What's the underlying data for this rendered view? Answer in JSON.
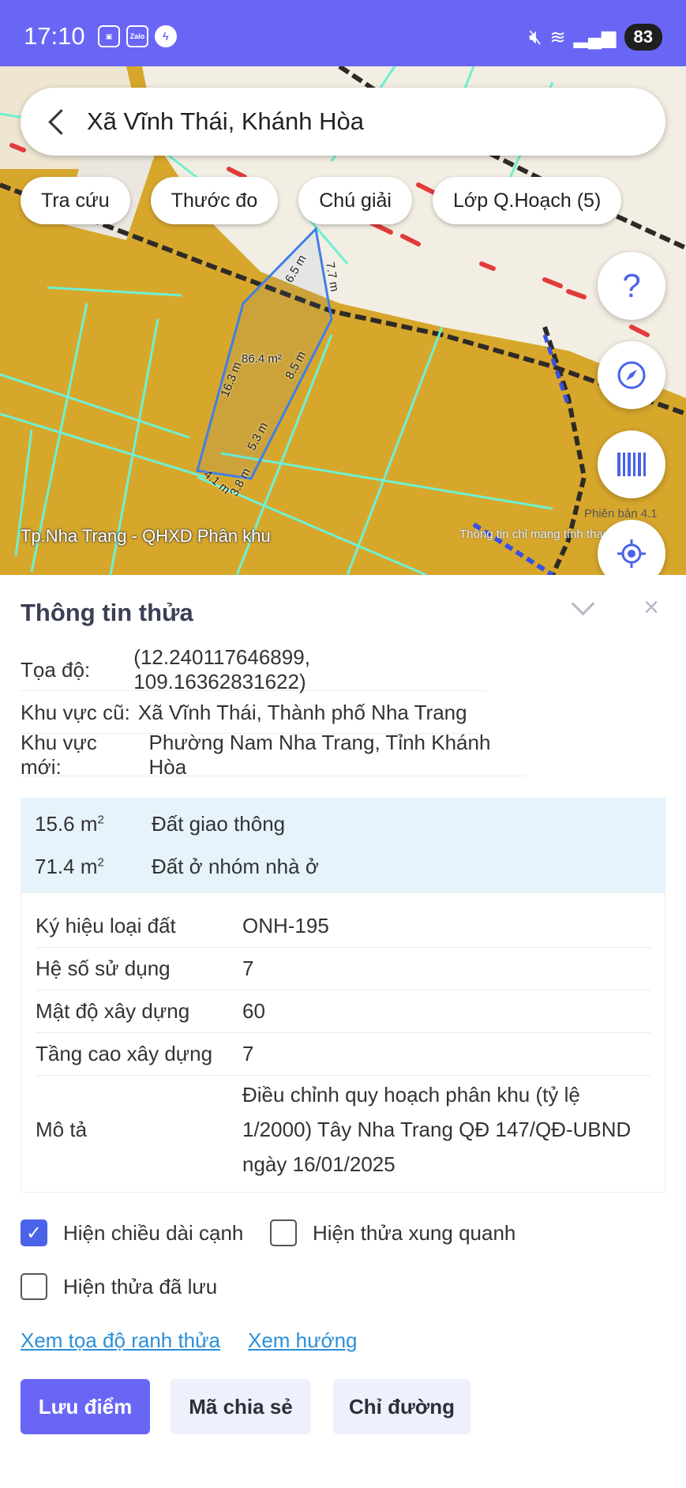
{
  "status_bar": {
    "time": "17:10",
    "zalo_label": "Zalo",
    "battery": "83"
  },
  "search": {
    "text": "Xã Vĩnh Thái, Khánh Hòa"
  },
  "chips": [
    "Tra cứu",
    "Thước đo",
    "Chú giải",
    "Lớp Q.Hoạch (5)"
  ],
  "map": {
    "fab_help": "?",
    "zone_label": "Tp.Nha Trang - QHXD Phân khu",
    "version_label": "Phiên bản 4.1",
    "disclaimer_label": "Thông tin chỉ mang tính tham khảo",
    "parcel_area": "86.4 m²",
    "edges": [
      "6.5 m",
      "7.7 m",
      "8.5 m",
      "16.3 m",
      "5.3 m",
      "3.8 m",
      "4.1 m"
    ]
  },
  "panel": {
    "title": "Thông tin thửa",
    "coord_label": "Tọa độ:",
    "coord_value": "(12.240117646899, 109.16362831622)",
    "old_area_label": "Khu vực cũ:",
    "old_area_value": "Xã Vĩnh Thái, Thành phố Nha Trang",
    "new_area_label": "Khu vực mới:",
    "new_area_value": "Phường Nam Nha Trang, Tỉnh Khánh Hòa"
  },
  "land_use": [
    {
      "area": "15.6 m",
      "sup": "2",
      "type": "Đất giao thông"
    },
    {
      "area": "71.4 m",
      "sup": "2",
      "type": "Đất ở nhóm nhà ở"
    }
  ],
  "props": [
    {
      "label": "Ký hiệu loại đất",
      "value": "ONH-195"
    },
    {
      "label": "Hệ số sử dụng",
      "value": "7"
    },
    {
      "label": "Mật độ xây dựng",
      "value": "60"
    },
    {
      "label": "Tầng cao xây dựng",
      "value": "7"
    }
  ],
  "description": {
    "label": "Mô tả",
    "line1": "Điều chỉnh quy hoạch phân khu (tỷ lệ",
    "line2": "1/2000) Tây Nha Trang QĐ 147/QĐ-UBND",
    "line3": "ngày 16/01/2025"
  },
  "checkboxes": {
    "show_edge_length": {
      "label": "Hiện chiều dài cạnh",
      "checked": true
    },
    "show_neighbor": {
      "label": "Hiện thửa xung quanh",
      "checked": false
    },
    "show_saved": {
      "label": "Hiện thửa đã lưu",
      "checked": false
    }
  },
  "links": {
    "coords": "Xem tọa độ ranh thửa",
    "direction": "Xem hướng"
  },
  "buttons": {
    "save": "Lưu điểm",
    "share": "Mã chia sẻ",
    "route": "Chỉ đường"
  },
  "colors": {
    "accent": "#6966f6",
    "map_land": "#d7a72c",
    "map_road": "#f3eee3",
    "link": "#2a8fd8",
    "parcel_outline": "#3f7fe6"
  }
}
